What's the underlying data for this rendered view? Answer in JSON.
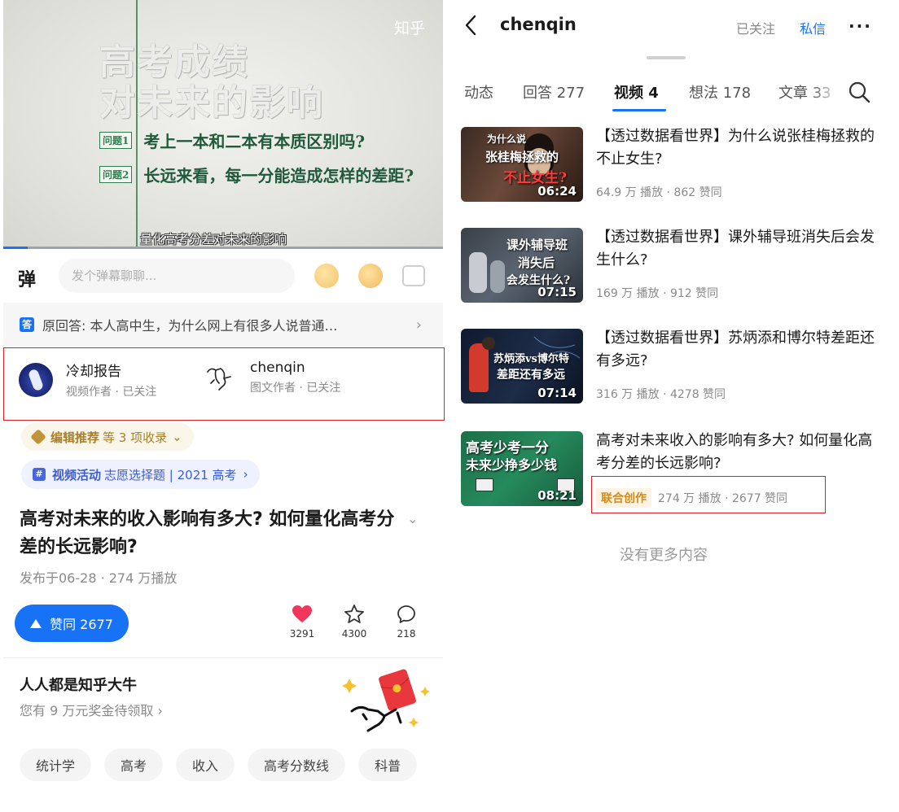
{
  "left": {
    "video": {
      "watermark": "知乎",
      "title_line1": "高考成绩",
      "title_line2": "对未来的影响",
      "q1_tag": "问题1",
      "q1_text": "考上一本和二本有本质区别吗?",
      "q2_tag": "问题2",
      "q2_text": "长远来看，每一分能造成怎样的差距?",
      "subtitle": "量化高考分差对未来的影响",
      "progress": 0.055
    },
    "danmu": {
      "icon": "弹",
      "placeholder": "发个弹幕聊聊..."
    },
    "original_answer": {
      "icon": "🅰",
      "text": "原回答: 本人高中生，为什么网上有很多人说普通…",
      "chevron": "›"
    },
    "authors": [
      {
        "name": "冷却报告",
        "role": "视频作者 · 已关注"
      },
      {
        "name": "chenqin",
        "role": "图文作者 · 已关注"
      }
    ],
    "chip_recommend": {
      "bold": "编辑推荐",
      "text": "等 3 项收录",
      "chevron": "⌄"
    },
    "chip_activity": {
      "bold": "视频活动",
      "text": "志愿选择题 | 2021 高考",
      "chevron": "›"
    },
    "title": "高考对未来的收入影响有多大? 如何量化高考分差的长远影响?",
    "title_chevron": "⌄",
    "meta": "发布于06-28 · 274 万播放",
    "like_button": "赞同 2677",
    "actions": [
      {
        "icon": "heart-icon",
        "count": "3291"
      },
      {
        "icon": "star-icon",
        "count": "4300"
      },
      {
        "icon": "comment-icon",
        "count": "218"
      }
    ],
    "promo": {
      "title": "人人都是知乎大牛",
      "subtitle": "您有 9 万元奖金待领取 ›"
    },
    "tags": [
      "统计学",
      "高考",
      "收入",
      "高考分数线",
      "科普"
    ]
  },
  "right": {
    "username": "chenqin",
    "followed_label": "已关注",
    "message_label": "私信",
    "more_label": "···",
    "tabs": [
      "动态",
      "回答 277",
      "视频 4",
      "想法 178",
      "文章 33"
    ],
    "active_tab": 2,
    "videos": [
      {
        "title": "【透过数据看世界】为什么说张桂梅拯救的不止女生?",
        "meta": "64.9 万 播放 · 862 赞同",
        "thumb_lines": [
          "为什么说",
          "张桂梅拯救的",
          "不止女生?"
        ],
        "duration": "06:24",
        "collab": ""
      },
      {
        "title": "【透过数据看世界】课外辅导班消失后会发生什么?",
        "meta": "169 万 播放 · 912 赞同",
        "thumb_lines": [
          "课外辅导班",
          "消失后",
          "会发生什么?"
        ],
        "duration": "07:15",
        "collab": ""
      },
      {
        "title": "【透过数据看世界】苏炳添和博尔特差距还有多远?",
        "meta": "316 万 播放 · 4278 赞同",
        "thumb_lines": [
          "苏炳添vs博尔特",
          "差距还有多远"
        ],
        "duration": "07:14",
        "collab": ""
      },
      {
        "title": "高考对未来收入的影响有多大? 如何量化高考分差的长远影响?",
        "meta": "274 万 播放 · 2677 赞同",
        "thumb_lines": [
          "高考少考一分",
          "未来少挣多少钱"
        ],
        "duration": "08:21",
        "collab": "联合创作"
      }
    ],
    "no_more": "没有更多内容"
  }
}
